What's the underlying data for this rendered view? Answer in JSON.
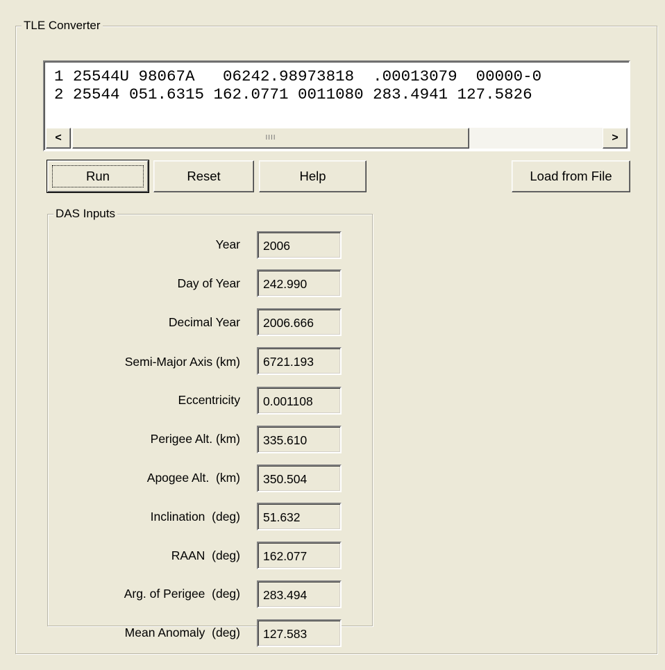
{
  "converter": {
    "title": "TLE Converter",
    "tle_lines": [
      "1 25544U 98067A   06242.98973818  .00013079  00000-0",
      "2 25544 051.6315 162.0771 0011080 283.4941 127.5826"
    ],
    "scroll_left_glyph": "<",
    "scroll_right_glyph": ">",
    "scroll_grip": "IIII"
  },
  "buttons": {
    "run": "Run",
    "reset": "Reset",
    "help": "Help",
    "load": "Load from File"
  },
  "das": {
    "title": "DAS Inputs",
    "rows": [
      {
        "label": "Year",
        "value": "2006"
      },
      {
        "label": "Day of Year",
        "value": "242.990"
      },
      {
        "label": "Decimal Year",
        "value": "2006.666"
      },
      {
        "label": "Semi-Major Axis (km)",
        "value": "6721.193"
      },
      {
        "label": "Eccentricity",
        "value": "0.001108"
      },
      {
        "label": "Perigee Alt. (km)",
        "value": "335.610"
      },
      {
        "label": "Apogee Alt.  (km)",
        "value": "350.504"
      },
      {
        "label": "Inclination  (deg)",
        "value": "51.632"
      },
      {
        "label": "RAAN  (deg)",
        "value": "162.077"
      },
      {
        "label": "Arg. of Perigee  (deg)",
        "value": "283.494"
      },
      {
        "label": "Mean Anomaly  (deg)",
        "value": "127.583"
      }
    ]
  }
}
